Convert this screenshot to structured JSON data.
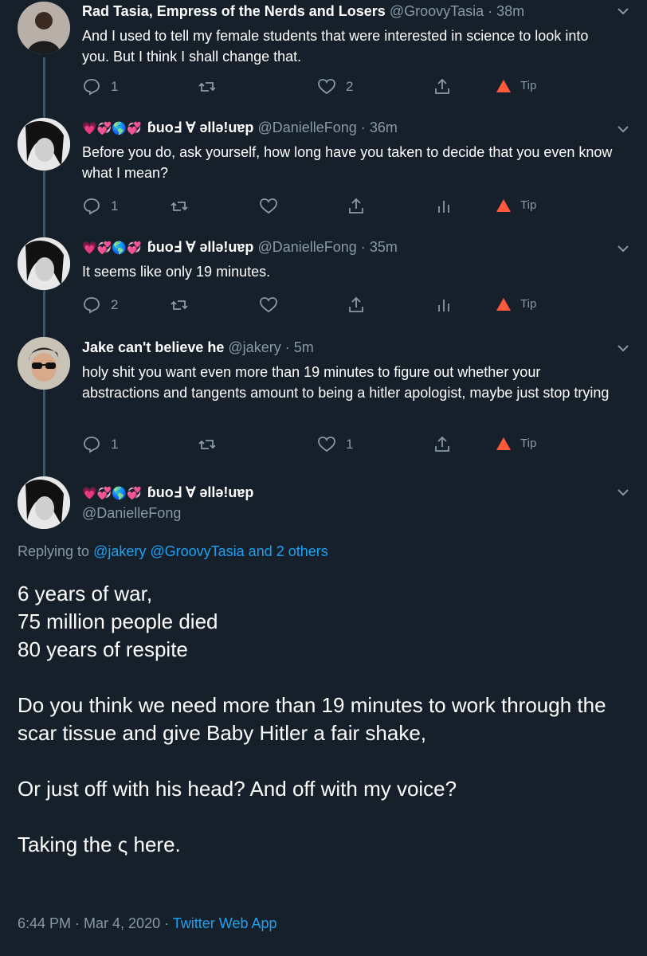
{
  "tweets": [
    {
      "name": "Rad Tasia, Empress of the Nerds and Losers",
      "handle": "@GroovyTasia",
      "time": "38m",
      "text": "And I used to tell my female students that were interested in science to look into you. But I think I shall change that.",
      "replies": "1",
      "retweets": "",
      "likes": "2",
      "tip": "Tip"
    },
    {
      "name": "ɓuoℲ ∀ ǝllǝ!uɐp",
      "handle": "@DanielleFong",
      "time": "36m",
      "text": "Before you do, ask yourself, how long have you taken to  decide that you even know what I mean?",
      "replies": "1",
      "retweets": "",
      "likes": "",
      "tip": "Tip"
    },
    {
      "name": "ɓuoℲ ∀ ǝllǝ!uɐp",
      "handle": "@DanielleFong",
      "time": "35m",
      "text": "It seems like only 19 minutes.",
      "replies": "2",
      "retweets": "",
      "likes": "",
      "tip": "Tip"
    },
    {
      "name": "Jake can't believe he",
      "handle": "@jakery",
      "time": "5m",
      "text": "holy shit you want even more than 19 minutes to figure out whether your abstractions and tangents amount to being a hitler apologist, maybe just stop trying",
      "replies": "1",
      "retweets": "",
      "likes": "1",
      "tip": "Tip"
    }
  ],
  "main": {
    "name": "ɓuoℲ ∀ ǝllǝ!uɐp",
    "handle": "@DanielleFong",
    "replying_prefix": "Replying to",
    "replying_to": "@jakery @GroovyTasia and 2 others",
    "lines": [
      "6 years of war,",
      "75 million people died",
      "80 years of respite",
      "",
      "Do you think we need more than 19 minutes to work through the scar tissue and give Baby Hitler a fair shake,",
      "",
      "Or just off with his head? And off with my voice?",
      "",
      "Taking the ς here."
    ],
    "timestamp": "6:44 PM · Mar 4, 2020 · ",
    "app": "Twitter Web App"
  },
  "emoji_prefix": "💗💞🌎💞",
  "dot": "·",
  "colors": {
    "background": "#15202b",
    "secondary_text": "#8899a6",
    "link": "#1da1f2",
    "thread_line": "#3d5466",
    "tip_icon": "#ff5a3c"
  }
}
